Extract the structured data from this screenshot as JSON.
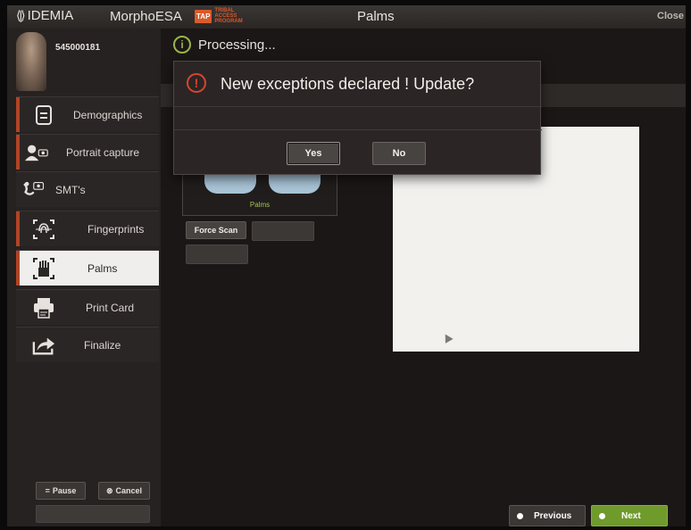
{
  "titlebar": {
    "brand": "IDEMIA",
    "app_name": "MorphoESA",
    "tap_badge": "TAP",
    "tap_text": "TRIBAL ACCESS PROGRAM",
    "title": "Palms",
    "close": "Close"
  },
  "user": {
    "id": "545000181"
  },
  "sidebar": {
    "items": [
      {
        "label": "Demographics",
        "icon": "document-icon"
      },
      {
        "label": "Portrait capture",
        "icon": "portrait-camera-icon"
      },
      {
        "label": "SMT's",
        "icon": "smt-camera-icon"
      },
      {
        "label": "Fingerprints",
        "icon": "fingerprint-icon"
      },
      {
        "label": "Palms",
        "icon": "palm-icon",
        "active": true
      },
      {
        "label": "Print Card",
        "icon": "printer-icon"
      },
      {
        "label": "Finalize",
        "icon": "export-icon"
      }
    ],
    "pause": "Pause",
    "cancel": "Cancel"
  },
  "main": {
    "status": "Processing...",
    "palm_label": "Palms",
    "force_scan": "Force Scan",
    "previous": "Previous",
    "next": "Next"
  },
  "dialog": {
    "message": "New exceptions declared ! Update?",
    "yes": "Yes",
    "no": "No"
  },
  "colors": {
    "accent_red": "#b14326",
    "next_green": "#6f9a2c",
    "status_green": "#9ab54a",
    "warning_red": "#d8442f"
  }
}
